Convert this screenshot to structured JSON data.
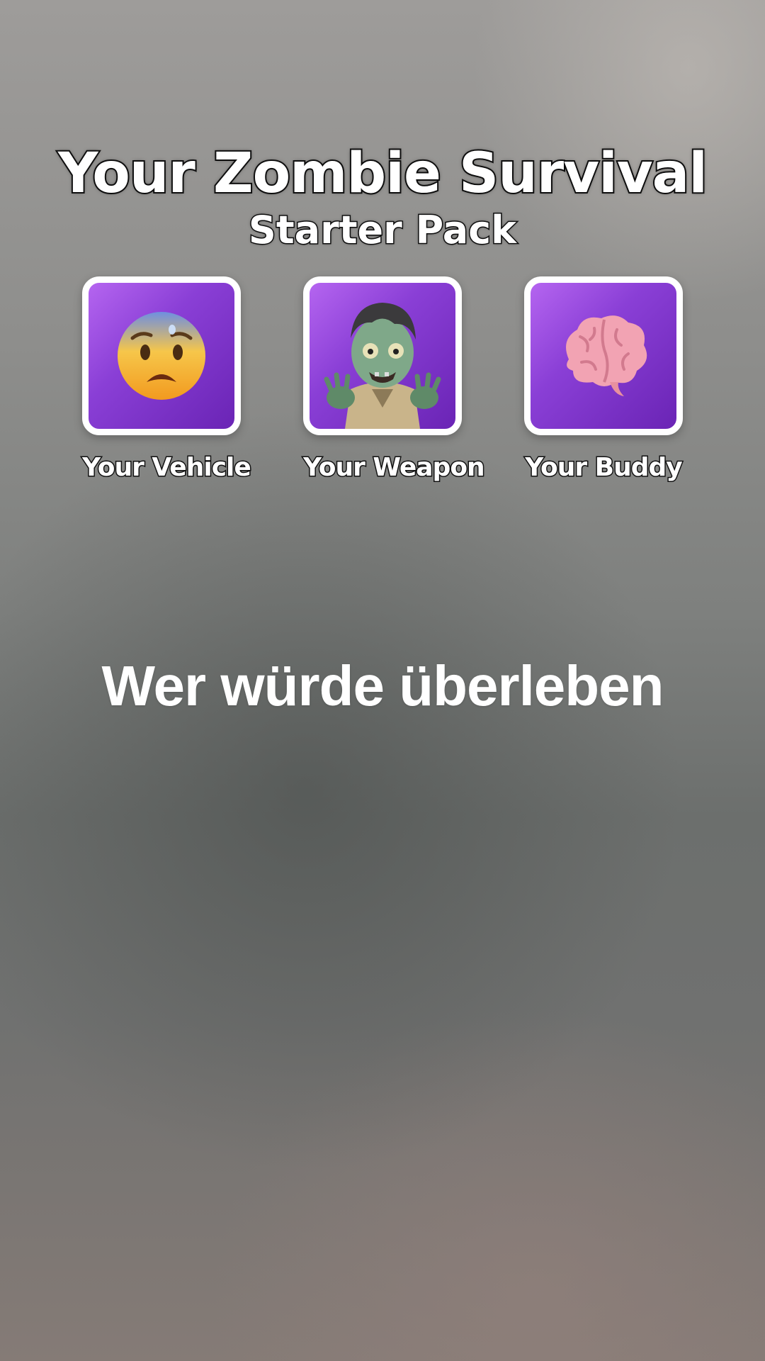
{
  "title": {
    "main": "Your Zombie Survival",
    "sub": "Starter Pack"
  },
  "cards": [
    {
      "label": "Your Vehicle",
      "icon": "anxious-face-icon"
    },
    {
      "label": "Your Weapon",
      "icon": "zombie-icon"
    },
    {
      "label": "Your Buddy",
      "icon": "brain-icon"
    }
  ],
  "question": "Wer würde überleben",
  "colors": {
    "tile_gradient_start": "#b565f0",
    "tile_gradient_end": "#6a24b5",
    "tile_border": "#ffffff",
    "text": "#ffffff",
    "text_outline": "#111111"
  }
}
